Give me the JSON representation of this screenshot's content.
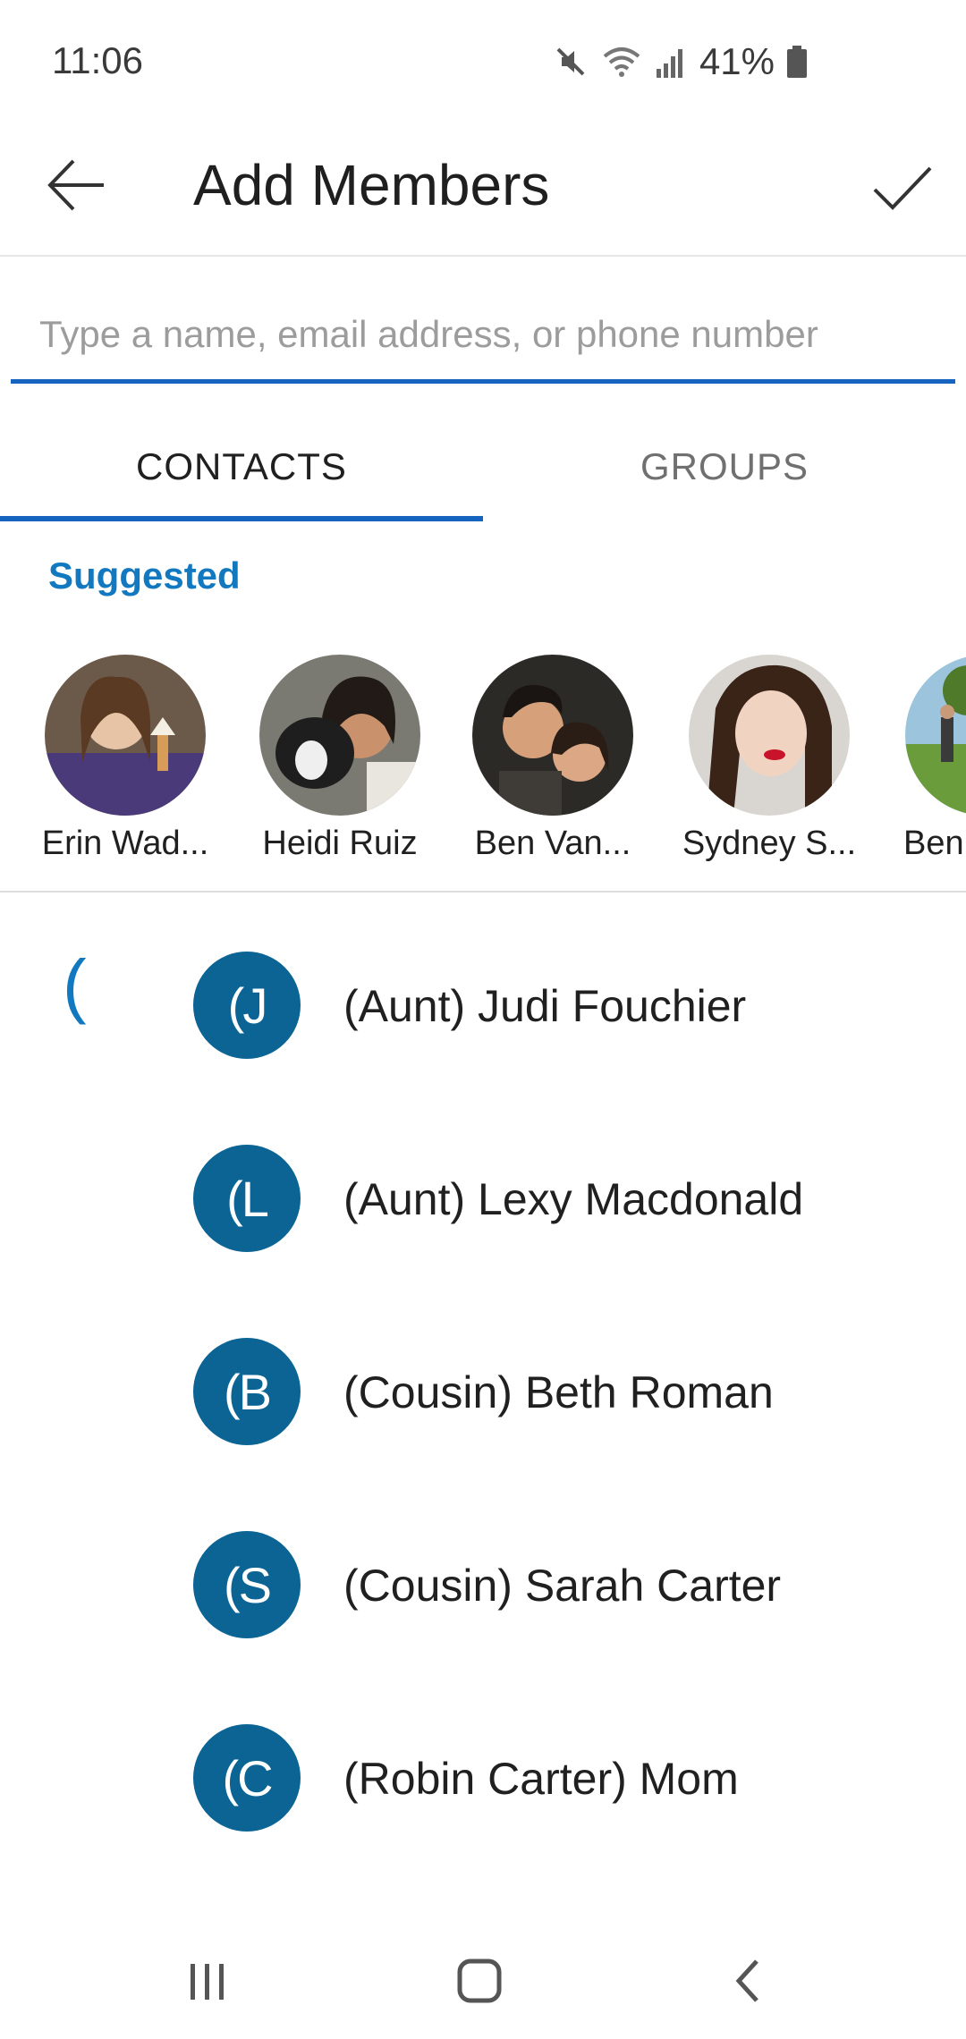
{
  "status_bar": {
    "time": "11:06",
    "battery": "41%",
    "icons": [
      "mute-icon",
      "wifi-icon",
      "signal-icon",
      "battery-icon"
    ]
  },
  "header": {
    "title": "Add Members",
    "back_icon": "arrow-left-icon",
    "done_icon": "checkmark-icon"
  },
  "search": {
    "placeholder": "Type a name, email address, or phone number",
    "value": ""
  },
  "tabs": [
    {
      "label": "CONTACTS",
      "selected": true
    },
    {
      "label": "GROUPS",
      "selected": false
    }
  ],
  "suggested": {
    "heading": "Suggested",
    "people": [
      {
        "name": "Erin Wad..."
      },
      {
        "name": "Heidi Ruiz"
      },
      {
        "name": "Ben Van..."
      },
      {
        "name": "Sydney S..."
      },
      {
        "name": "Ben"
      }
    ]
  },
  "contacts": {
    "section_index": "(",
    "items": [
      {
        "initials": "(J",
        "name": "(Aunt) Judi Fouchier"
      },
      {
        "initials": "(L",
        "name": "(Aunt) Lexy Macdonald"
      },
      {
        "initials": "(B",
        "name": "(Cousin) Beth Roman"
      },
      {
        "initials": "(S",
        "name": "(Cousin) Sarah Carter"
      },
      {
        "initials": "(C",
        "name": "(Robin Carter) Mom"
      }
    ]
  },
  "nav_bar": {
    "icons": [
      "recent-apps-icon",
      "home-icon",
      "back-icon"
    ]
  },
  "colors": {
    "accent": "#1565c0",
    "avatar_bg": "#0b6494",
    "suggested_heading": "#1279c0"
  }
}
